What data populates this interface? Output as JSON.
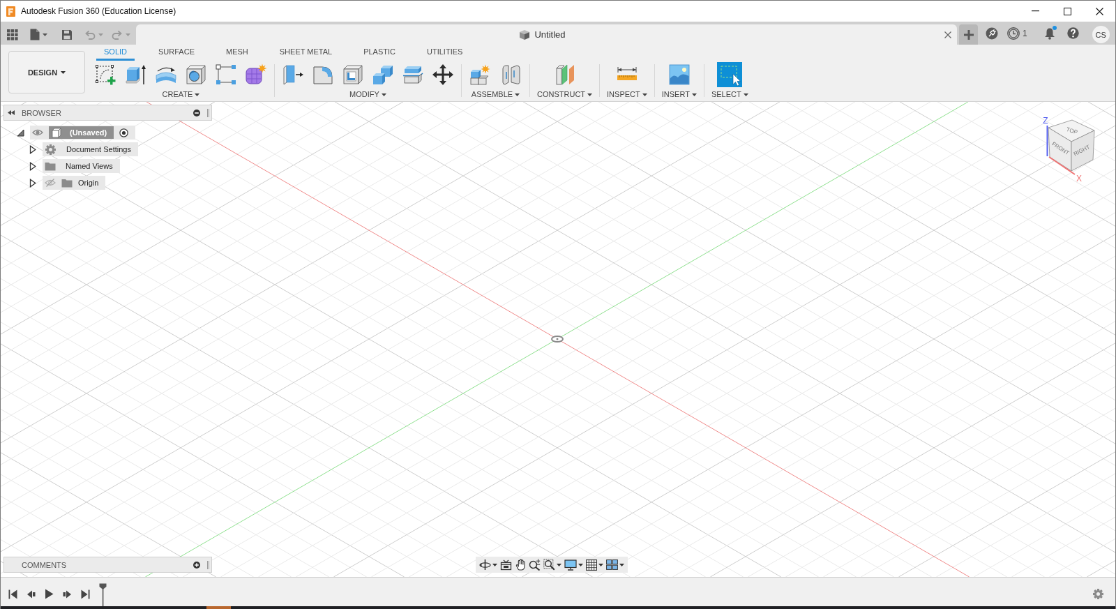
{
  "window": {
    "title": "Autodesk Fusion 360 (Education License)"
  },
  "quick_access": {
    "undo": {
      "disabled": true
    },
    "redo": {
      "disabled": true
    }
  },
  "document_tab": {
    "title": "Untitled"
  },
  "account": {
    "job_count": "1",
    "notifications_unread": true,
    "initials": "CS"
  },
  "workspace": {
    "label": "DESIGN"
  },
  "ribbon": {
    "tabs": [
      {
        "label": "SOLID",
        "selected": true
      },
      {
        "label": "SURFACE",
        "selected": false
      },
      {
        "label": "MESH",
        "selected": false
      },
      {
        "label": "SHEET METAL",
        "selected": false
      },
      {
        "label": "PLASTIC",
        "selected": false
      },
      {
        "label": "UTILITIES",
        "selected": false
      }
    ],
    "groups": [
      {
        "kind": "create",
        "label": "CREATE"
      },
      {
        "kind": "modify",
        "label": "MODIFY"
      },
      {
        "kind": "assemble",
        "label": "ASSEMBLE"
      },
      {
        "kind": "construct",
        "label": "CONSTRUCT"
      },
      {
        "kind": "inspect",
        "label": "INSPECT"
      },
      {
        "kind": "insert",
        "label": "INSERT"
      },
      {
        "kind": "select",
        "label": "SELECT"
      }
    ]
  },
  "browser": {
    "title": "BROWSER",
    "tree": [
      {
        "kind": "component",
        "label": "(Unsaved)",
        "expanded": true,
        "visible": true,
        "active": true,
        "children": [
          {
            "kind": "settings",
            "label": "Document Settings",
            "expanded": false
          },
          {
            "kind": "folder",
            "label": "Named Views",
            "expanded": false
          },
          {
            "kind": "folder",
            "label": "Origin",
            "expanded": false,
            "visible": false
          }
        ]
      }
    ]
  },
  "view_cube": {
    "faces": [
      {
        "kind": "top",
        "label": "TOP"
      },
      {
        "kind": "front",
        "label": "FRONT"
      },
      {
        "kind": "right",
        "label": "RIGHT"
      }
    ],
    "axes": [
      {
        "kind": "z",
        "label": "Z"
      },
      {
        "kind": "x",
        "label": "X"
      }
    ]
  },
  "comments": {
    "title": "COMMENTS"
  }
}
